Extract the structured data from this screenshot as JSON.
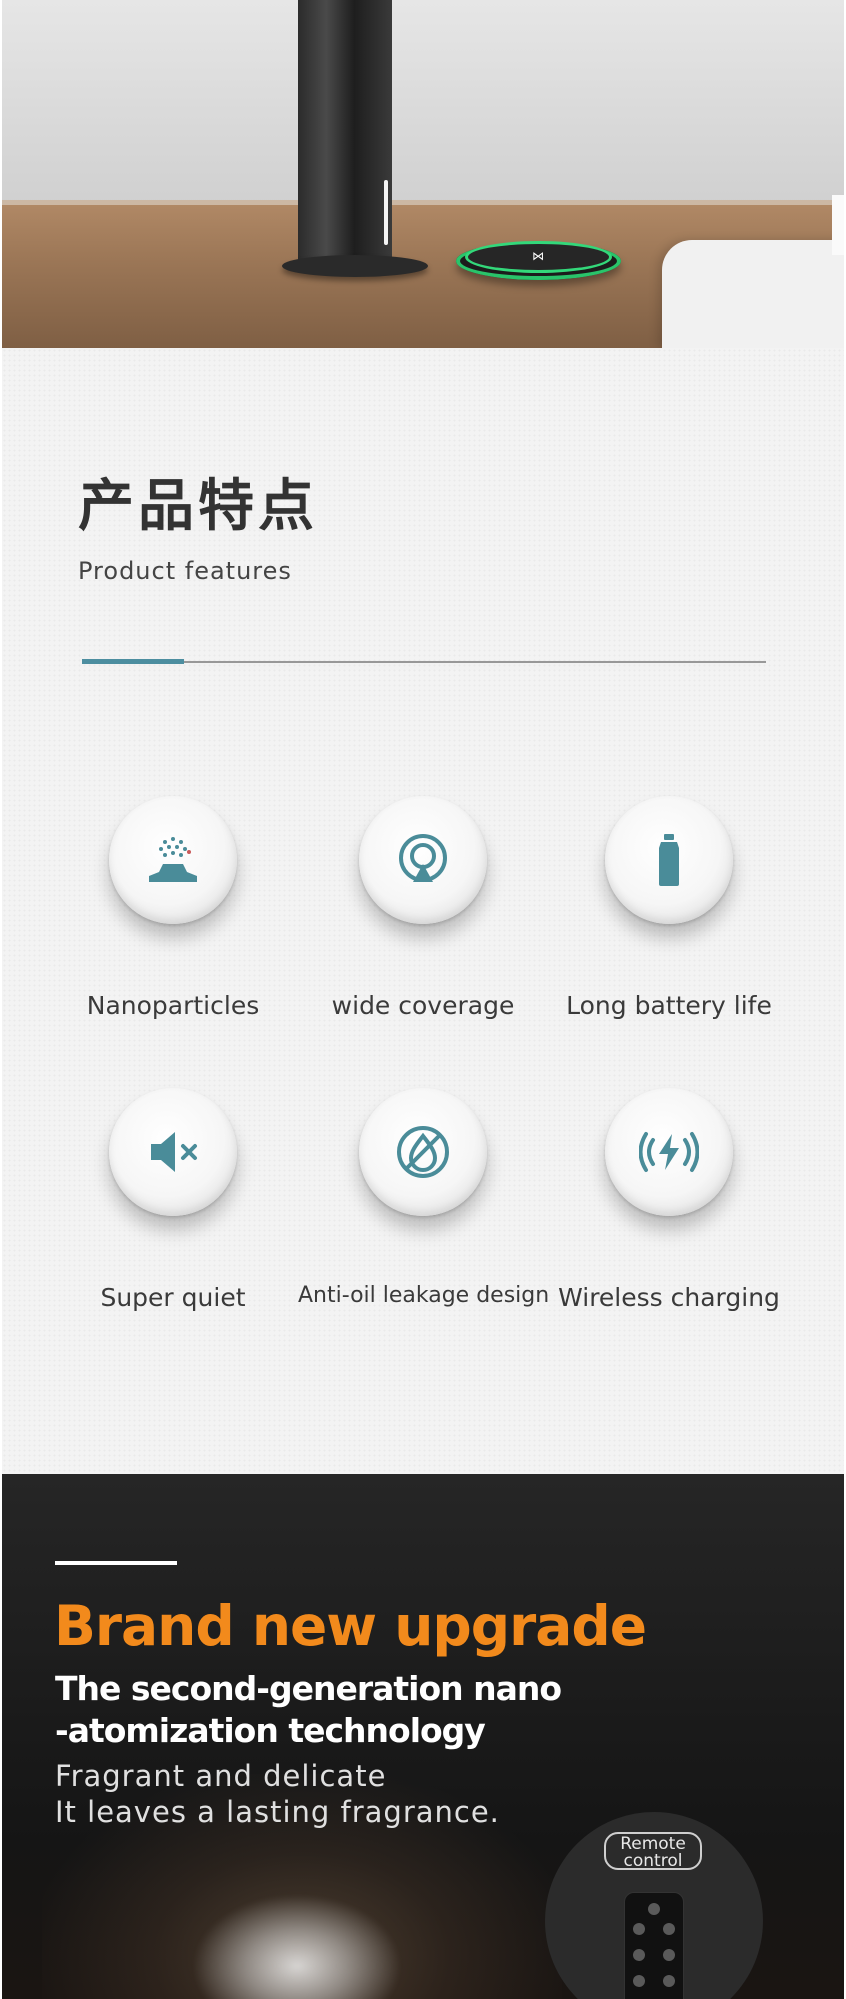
{
  "hero": {
    "pad_logo": "⋈"
  },
  "features_section": {
    "title_cn": "产品特点",
    "subtitle": "Product features",
    "accent_color": "#4d8ea0",
    "items": [
      {
        "label": "Nanoparticles",
        "icon": "nanoparticles-icon"
      },
      {
        "label": "wide coverage",
        "icon": "coverage-icon"
      },
      {
        "label": "Long battery life",
        "icon": "battery-icon"
      },
      {
        "label": "Super quiet",
        "icon": "mute-icon"
      },
      {
        "label": "Anti-oil leakage design",
        "icon": "no-oil-drop-icon"
      },
      {
        "label": "Wireless charging",
        "icon": "wireless-charging-icon"
      }
    ]
  },
  "upgrade_section": {
    "headline": "Brand new upgrade",
    "subheadline_line1": "The second-generation nano",
    "subheadline_line2": "-atomization technology",
    "desc_line1": "Fragrant and delicate",
    "desc_line2": "It leaves a lasting fragrance.",
    "headline_color": "#f28a1c",
    "remote_label_line1": "Remote",
    "remote_label_line2": "control"
  }
}
